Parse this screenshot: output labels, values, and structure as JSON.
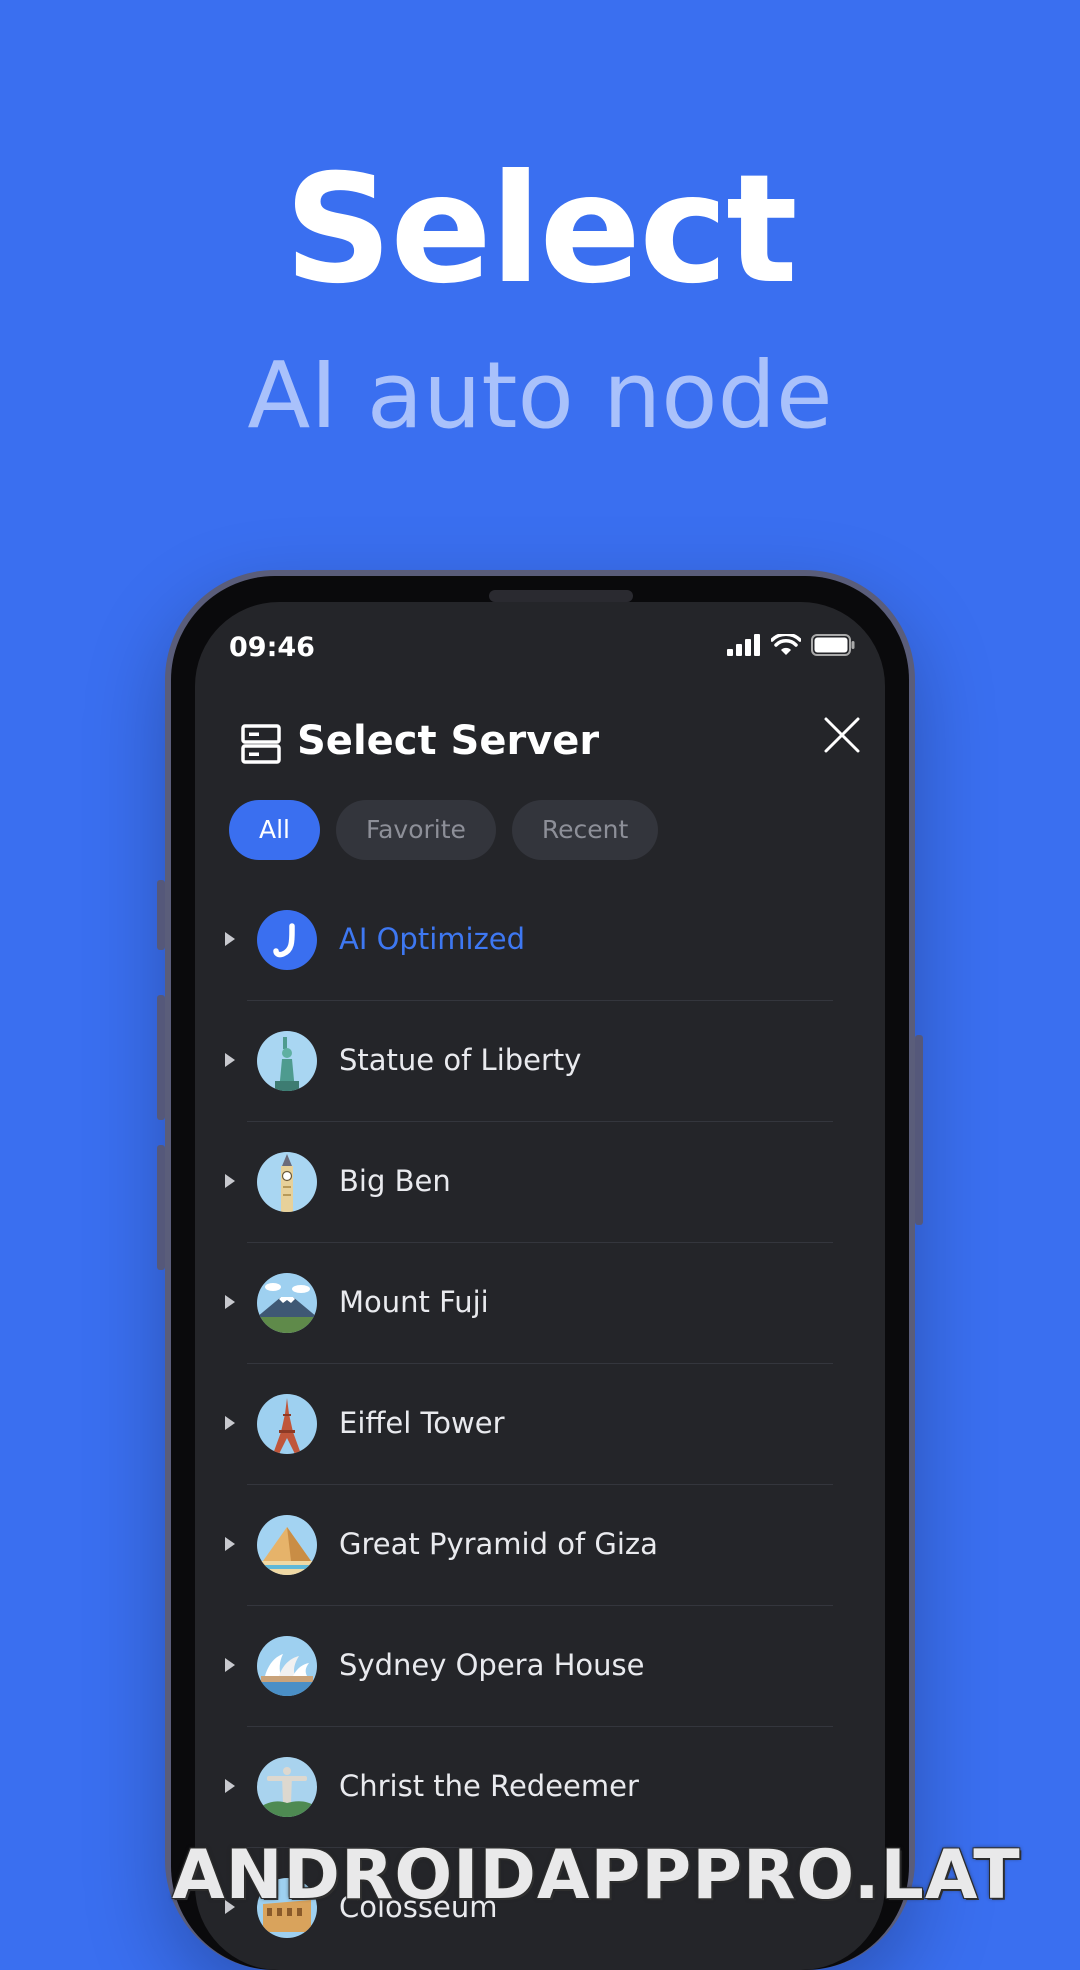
{
  "promo": {
    "headline": "Select",
    "subheadline": "AI auto node"
  },
  "status_bar": {
    "time": "09:46"
  },
  "server_screen": {
    "title": "Select Server",
    "tabs": [
      {
        "label": "All",
        "active": true
      },
      {
        "label": "Favorite",
        "active": false
      },
      {
        "label": "Recent",
        "active": false
      }
    ],
    "servers": [
      {
        "label": "AI Optimized",
        "icon": "ai-logo-icon",
        "highlighted": true
      },
      {
        "label": "Statue of Liberty",
        "icon": "statue-of-liberty-icon"
      },
      {
        "label": "Big Ben",
        "icon": "big-ben-icon"
      },
      {
        "label": "Mount Fuji",
        "icon": "mount-fuji-icon"
      },
      {
        "label": "Eiffel Tower",
        "icon": "eiffel-tower-icon"
      },
      {
        "label": "Great Pyramid of Giza",
        "icon": "pyramid-icon"
      },
      {
        "label": "Sydney Opera House",
        "icon": "opera-house-icon"
      },
      {
        "label": "Christ the Redeemer",
        "icon": "christ-redeemer-icon"
      },
      {
        "label": "Colosseum",
        "icon": "colosseum-icon"
      }
    ]
  },
  "watermark": "ANDROIDAPPPRO.LAT",
  "colors": {
    "background": "#3a6ff0",
    "accent": "#3e78f2",
    "screen": "#242529"
  }
}
